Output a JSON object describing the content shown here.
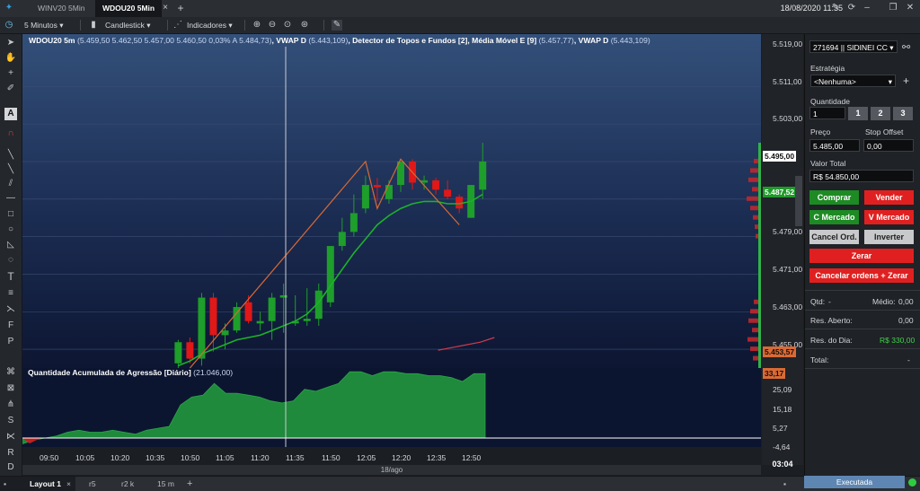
{
  "tabs": [
    {
      "label": "WINV20 5Min"
    },
    {
      "label": "WDOU20 5Min"
    }
  ],
  "datetime": "18/08/2020 11:35",
  "toolbar": {
    "interval": "5 Minutos",
    "chart_type": "Candlestick",
    "indicators": "Indicadores"
  },
  "info": {
    "symbol": "WDOU20 5m",
    "ohlc": "(5.459,50  5.462,50  5.457,00  5.460,50  0,03%  A 5.484,73)",
    "vwap_label": ", VWAP D",
    "vwap_val": "(5.443,109)",
    "detector": ", Detector de Topos e Fundos [2], Média Móvel E [9]",
    "mme_val": "(5.457,77)",
    "vwap2_label": ", VWAP D",
    "vwap2_val": "(5.443,109)"
  },
  "indicator": {
    "label": "Quantidade Acumulada de Agressão [Diário]",
    "value": "(21.046,00)"
  },
  "price_ticks": [
    "5.519,00",
    "5.511,00",
    "5.503,00",
    "5.479,00",
    "5.471,00",
    "5.463,00",
    "5.455,00"
  ],
  "indicator_ticks": [
    "25,09",
    "15,18",
    "5,27",
    "-4,64"
  ],
  "price_labels": {
    "last": "5.495,00",
    "current": "5.487,52",
    "vwap": "5.453,57",
    "indicator": "33,17"
  },
  "time_ticks": [
    "09:50",
    "10:05",
    "10:20",
    "10:35",
    "10:50",
    "11:05",
    "11:20",
    "11:35",
    "11:50",
    "12:05",
    "12:20",
    "12:35",
    "12:50"
  ],
  "date_label": "18/ago",
  "clock": "03:04",
  "bottom": {
    "layout": "Layout 1",
    "t1": "r5",
    "t2": "r2 k",
    "t3": "15 m"
  },
  "panel": {
    "account": "271694 || SIDINEI CC",
    "estrategia_label": "Estratégia",
    "estrategia_value": "<Nenhuma>",
    "quantidade_label": "Quantidade",
    "quantidade_value": "1",
    "q_buttons": [
      "1",
      "2",
      "3"
    ],
    "preco_label": "Preço",
    "preco_value": "5.485,00",
    "stop_label": "Stop Offset",
    "stop_value": "0,00",
    "valor_label": "Valor Total",
    "valor_value": "R$ 54.850,00",
    "comprar": "Comprar",
    "vender": "Vender",
    "c_mercado": "C Mercado",
    "v_mercado": "V Mercado",
    "cancel_ord": "Cancel Ord.",
    "inverter": "Inverter",
    "zerar": "Zerar",
    "cancelar_zerar": "Cancelar ordens + Zerar",
    "qtd_label": "Qtd:",
    "qtd_value": "-",
    "medio_label": "Médio:",
    "medio_value": "0,00",
    "res_aberto_label": "Res. Aberto:",
    "res_aberto_value": "0,00",
    "res_dia_label": "Res. do Dia:",
    "res_dia_value": "R$ 330,00",
    "total_label": "Total:",
    "total_value": "-"
  },
  "status": "Executada",
  "colors": {
    "up": "#1e9e2a",
    "down": "#e01818",
    "mme": "#1bb32a",
    "topos": "#d96a35"
  },
  "chart_data": {
    "type": "candlestick",
    "ylim": [
      5451,
      5521
    ],
    "times": [
      "10:45",
      "10:50",
      "10:55",
      "11:00",
      "11:05",
      "11:10",
      "11:15",
      "11:20",
      "11:25",
      "11:30",
      "11:35",
      "11:40",
      "11:45",
      "11:50",
      "11:55",
      "12:00",
      "12:05",
      "12:10",
      "12:15",
      "12:20",
      "12:25",
      "12:30",
      "12:35",
      "12:40",
      "12:45",
      "12:50",
      "12:55"
    ],
    "ohlc": [
      [
        5452.0,
        5457.0,
        5451.0,
        5456.5
      ],
      [
        5456.5,
        5457.5,
        5452.0,
        5453.0
      ],
      [
        5453.0,
        5467.0,
        5451.5,
        5466.0
      ],
      [
        5466.0,
        5467.0,
        5454.5,
        5458.0
      ],
      [
        5458.0,
        5460.5,
        5455.0,
        5459.0
      ],
      [
        5459.0,
        5465.0,
        5458.5,
        5464.0
      ],
      [
        5465.0,
        5466.5,
        5460.5,
        5461.0
      ],
      [
        5460.5,
        5463.0,
        5459.0,
        5461.0
      ],
      [
        5461.0,
        5467.0,
        5457.0,
        5466.0
      ],
      [
        5466.0,
        5469.0,
        5458.5,
        5466.5
      ],
      [
        5460.5,
        5466.5,
        5460.0,
        5461.0
      ],
      [
        5461.0,
        5468.0,
        5460.0,
        5461.5
      ],
      [
        5461.5,
        5469.0,
        5460.0,
        5467.5
      ],
      [
        5465.0,
        5474.0,
        5464.0,
        5477.0
      ],
      [
        5477.0,
        5483.0,
        5476.0,
        5480.0
      ],
      [
        5480.0,
        5488.0,
        5479.0,
        5484.0
      ],
      [
        5485.0,
        5492.0,
        5484.0,
        5490.0
      ],
      [
        5490.0,
        5491.5,
        5486.5,
        5489.5
      ],
      [
        5487.0,
        5491.0,
        5486.0,
        5490.0
      ],
      [
        5490.0,
        5495.0,
        5488.5,
        5495.0
      ],
      [
        5495.0,
        5495.5,
        5489.0,
        5490.5
      ],
      [
        5490.5,
        5492.0,
        5489.0,
        5491.0
      ],
      [
        5491.0,
        5491.5,
        5488.0,
        5489.0
      ],
      [
        5489.0,
        5491.0,
        5487.0,
        5487.5
      ],
      [
        5487.5,
        5488.0,
        5484.0,
        5485.0
      ],
      [
        5483.0,
        5490.0,
        5483.0,
        5490.0
      ],
      [
        5489.0,
        5499.0,
        5487.0,
        5495.0
      ]
    ],
    "mme": [
      5451.5,
      5452.5,
      5454.0,
      5455.0,
      5456.0,
      5457.0,
      5457.5,
      5458.0,
      5459.0,
      5460.0,
      5461.0,
      5462.5,
      5465.0,
      5468.5,
      5472.0,
      5475.5,
      5478.5,
      5481.5,
      5483.5,
      5485.0,
      5486.0,
      5486.5,
      5486.5,
      5486.0,
      5486.0,
      5486.5,
      5488.0
    ],
    "topos_fundos": [
      [
        "10:50",
        5451.0
      ],
      [
        "12:05",
        5495.0
      ],
      [
        "12:10",
        5485.0
      ],
      [
        "12:20",
        5495.5
      ],
      [
        "12:45",
        5481.5
      ]
    ],
    "vwap": [
      [
        12.6,
        5454.8
      ],
      [
        12.9,
        5456.5
      ],
      [
        13.0,
        5457.5
      ]
    ],
    "agressao": {
      "ylim": [
        -4.64,
        35
      ],
      "values": [
        -3,
        -1,
        0,
        1,
        3,
        4,
        3,
        3,
        4,
        3,
        2,
        4,
        5,
        6,
        17,
        21,
        22,
        28,
        23,
        23,
        22,
        21,
        19,
        18,
        19,
        25,
        24,
        26,
        28,
        34,
        34,
        32,
        34,
        34,
        33,
        33,
        32,
        32,
        31,
        29,
        33,
        33
      ]
    }
  }
}
